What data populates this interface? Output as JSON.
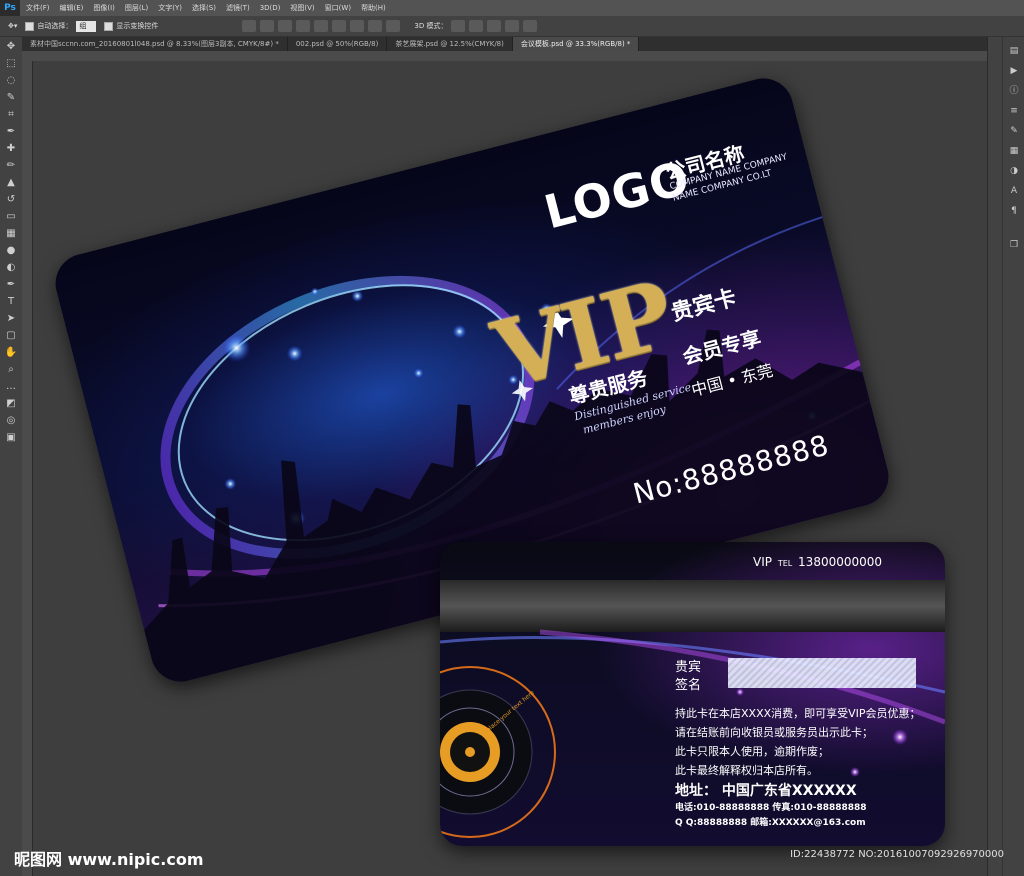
{
  "app": {
    "logo": "Ps",
    "accent": "#31a8ff"
  },
  "menu": [
    "文件(F)",
    "编辑(E)",
    "图像(I)",
    "图层(L)",
    "文字(Y)",
    "选择(S)",
    "滤镜(T)",
    "3D(D)",
    "视图(V)",
    "窗口(W)",
    "帮助(H)"
  ],
  "options": {
    "auto_select_label": "自动选择：",
    "auto_select_value": "组",
    "transform_label": "显示变换控件",
    "mode_3d_label": "3D 模式："
  },
  "tabs": [
    {
      "label": "素材中国sccnn.com_20160801l048.psd @ 8.33%(图层3副本, CMYK/8#) *",
      "active": false
    },
    {
      "label": "002.psd @ 50%(RGB/8)",
      "active": false
    },
    {
      "label": "茶艺展架.psd @ 12.5%(CMYK/8)",
      "active": false
    },
    {
      "label": "会议模板.psd @ 33.3%(RGB/8) *",
      "active": true
    }
  ],
  "front_card": {
    "logo": "LOGO",
    "company_cn": "公司名称",
    "company_en_1": "COMPANY NAME COMPANY",
    "company_en_2": "NAME COMPANY CO.LT",
    "vip": "VIP",
    "card_type": "贵宾卡",
    "slogan_1": "尊贵服务",
    "slogan_2": "会员专享",
    "cursive_1": "Distinguished service",
    "cursive_2": "members enjoy",
    "location": "中国 • 东莞",
    "number": "No:88888888",
    "colors": {
      "gold": "#d4af55",
      "blue_glow": "#2a7bff",
      "purple": "#9a3ad0"
    }
  },
  "back_card": {
    "tel_header_vip": "VIP",
    "tel_header_tel": "TEL",
    "tel_header_number": "13800000000",
    "sign_label_1": "贵宾",
    "sign_label_2": "签名",
    "rules": [
      "持此卡在本店XXXX消费，即可享受VIP会员优惠；",
      "请在结账前向收银员或服务员出示此卡；",
      "此卡只限本人使用，逾期作废；",
      "此卡最终解释权归本店所有。"
    ],
    "address": "地址：  中国广东省XXXXXX",
    "phone_line": "电话:010-88888888  传真:010-88888888",
    "qq_line": "Q Q:88888888   邮箱:XXXXXX@163.com",
    "disc_text": "place your text here"
  },
  "watermark": "昵图网 www.nipic.com",
  "image_id": "ID:22438772 NO:20161007092926970000"
}
